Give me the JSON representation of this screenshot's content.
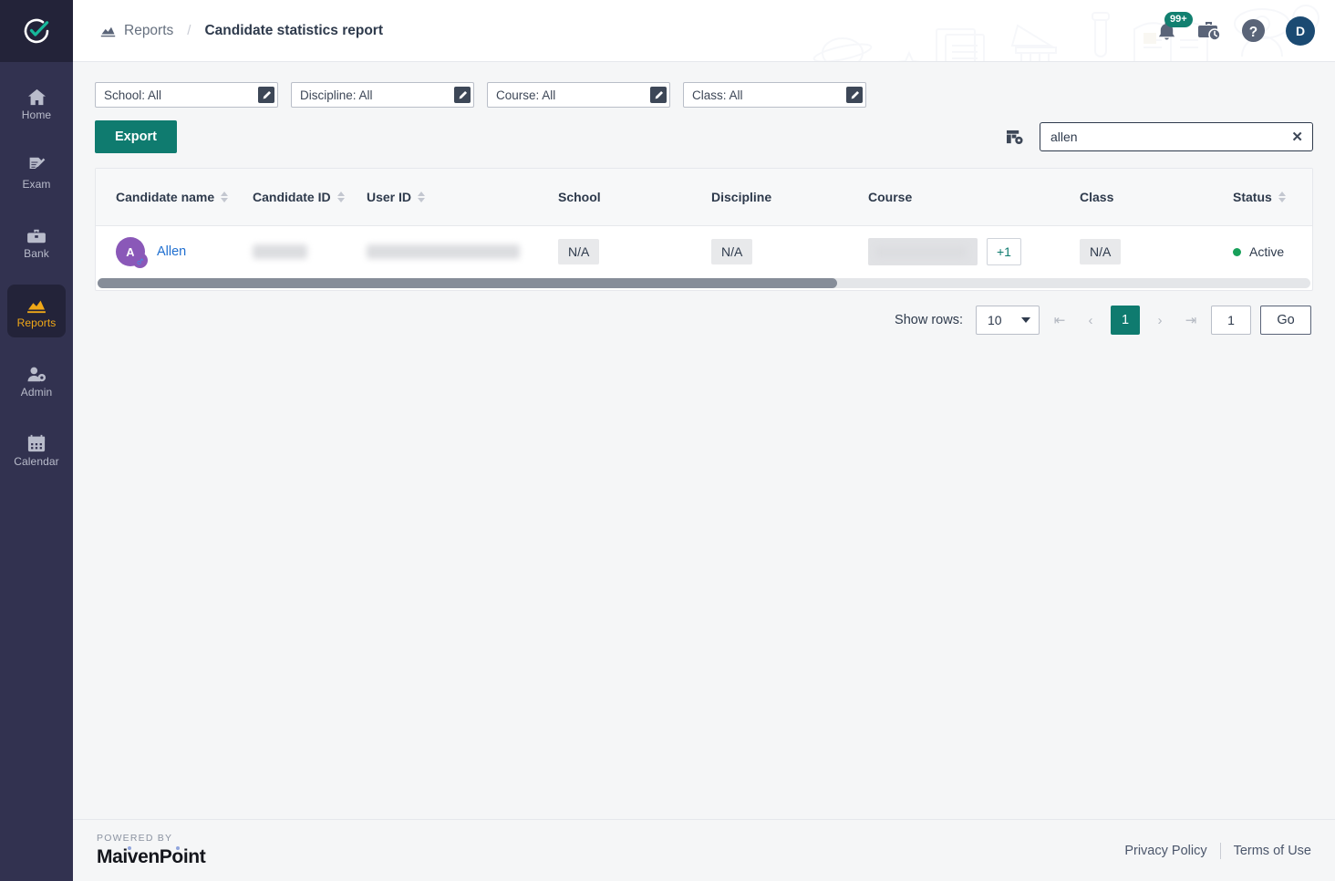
{
  "sidebar": {
    "logo_icon": "check-circle-logo-icon",
    "items": [
      {
        "label": "Home",
        "icon": "home-icon",
        "active": false
      },
      {
        "label": "Exam",
        "icon": "exam-pencil-icon",
        "active": false
      },
      {
        "label": "Bank",
        "icon": "bank-toolbox-icon",
        "active": false
      },
      {
        "label": "Reports",
        "icon": "reports-chart-icon",
        "active": true
      },
      {
        "label": "Admin",
        "icon": "admin-user-gear-icon",
        "active": false
      },
      {
        "label": "Calendar",
        "icon": "calendar-icon",
        "active": false
      }
    ]
  },
  "header": {
    "breadcrumb_icon": "reports-chart-icon",
    "breadcrumb_parent": "Reports",
    "breadcrumb_separator": "/",
    "breadcrumb_current": "Candidate statistics report",
    "notification_badge": "99+",
    "notification_icon": "bell-icon",
    "briefcase_icon": "briefcase-clock-icon",
    "help_icon": "help-question-icon",
    "avatar_initial": "D"
  },
  "filters": [
    {
      "label": "School: All",
      "edit_icon": "edit-pencil-icon"
    },
    {
      "label": "Discipline: All",
      "edit_icon": "edit-pencil-icon"
    },
    {
      "label": "Course: All",
      "edit_icon": "edit-pencil-icon"
    },
    {
      "label": "Class: All",
      "edit_icon": "edit-pencil-icon"
    }
  ],
  "actions": {
    "export_label": "Export",
    "column_settings_icon": "table-settings-icon",
    "search_value": "allen",
    "search_placeholder": "",
    "search_clear_icon": "close-icon"
  },
  "table": {
    "columns": [
      {
        "label": "Candidate name",
        "sortable": true
      },
      {
        "label": "Candidate ID",
        "sortable": true
      },
      {
        "label": "User ID",
        "sortable": true
      },
      {
        "label": "School",
        "sortable": false
      },
      {
        "label": "Discipline",
        "sortable": false
      },
      {
        "label": "Course",
        "sortable": false
      },
      {
        "label": "Class",
        "sortable": false
      },
      {
        "label": "Status",
        "sortable": true
      }
    ],
    "rows": [
      {
        "avatar_initial": "A",
        "gender_icon": "male-gender-icon",
        "candidate_name": "Allen",
        "candidate_id": "",
        "user_id": "",
        "school": "N/A",
        "discipline": "N/A",
        "course": "",
        "course_more": "+1",
        "class": "N/A",
        "status": "Active",
        "status_color": "#18a05a"
      }
    ]
  },
  "pagination": {
    "show_rows_label": "Show rows:",
    "rows_per_page": "10",
    "first_icon": "first-page-icon",
    "prev_icon": "prev-page-icon",
    "current_page": "1",
    "next_icon": "next-page-icon",
    "last_icon": "last-page-icon",
    "goto_value": "1",
    "go_label": "Go"
  },
  "footer": {
    "powered_by": "POWERED BY",
    "brand": "MaivenPoint",
    "privacy_label": "Privacy Policy",
    "terms_label": "Terms of Use"
  },
  "colors": {
    "accent_teal": "#0f7b6f",
    "sidebar_bg": "#323250",
    "active_nav": "#f0a818",
    "link_blue": "#1f6fd0",
    "status_green": "#18a05a",
    "avatar_purple": "#8a58b8"
  }
}
